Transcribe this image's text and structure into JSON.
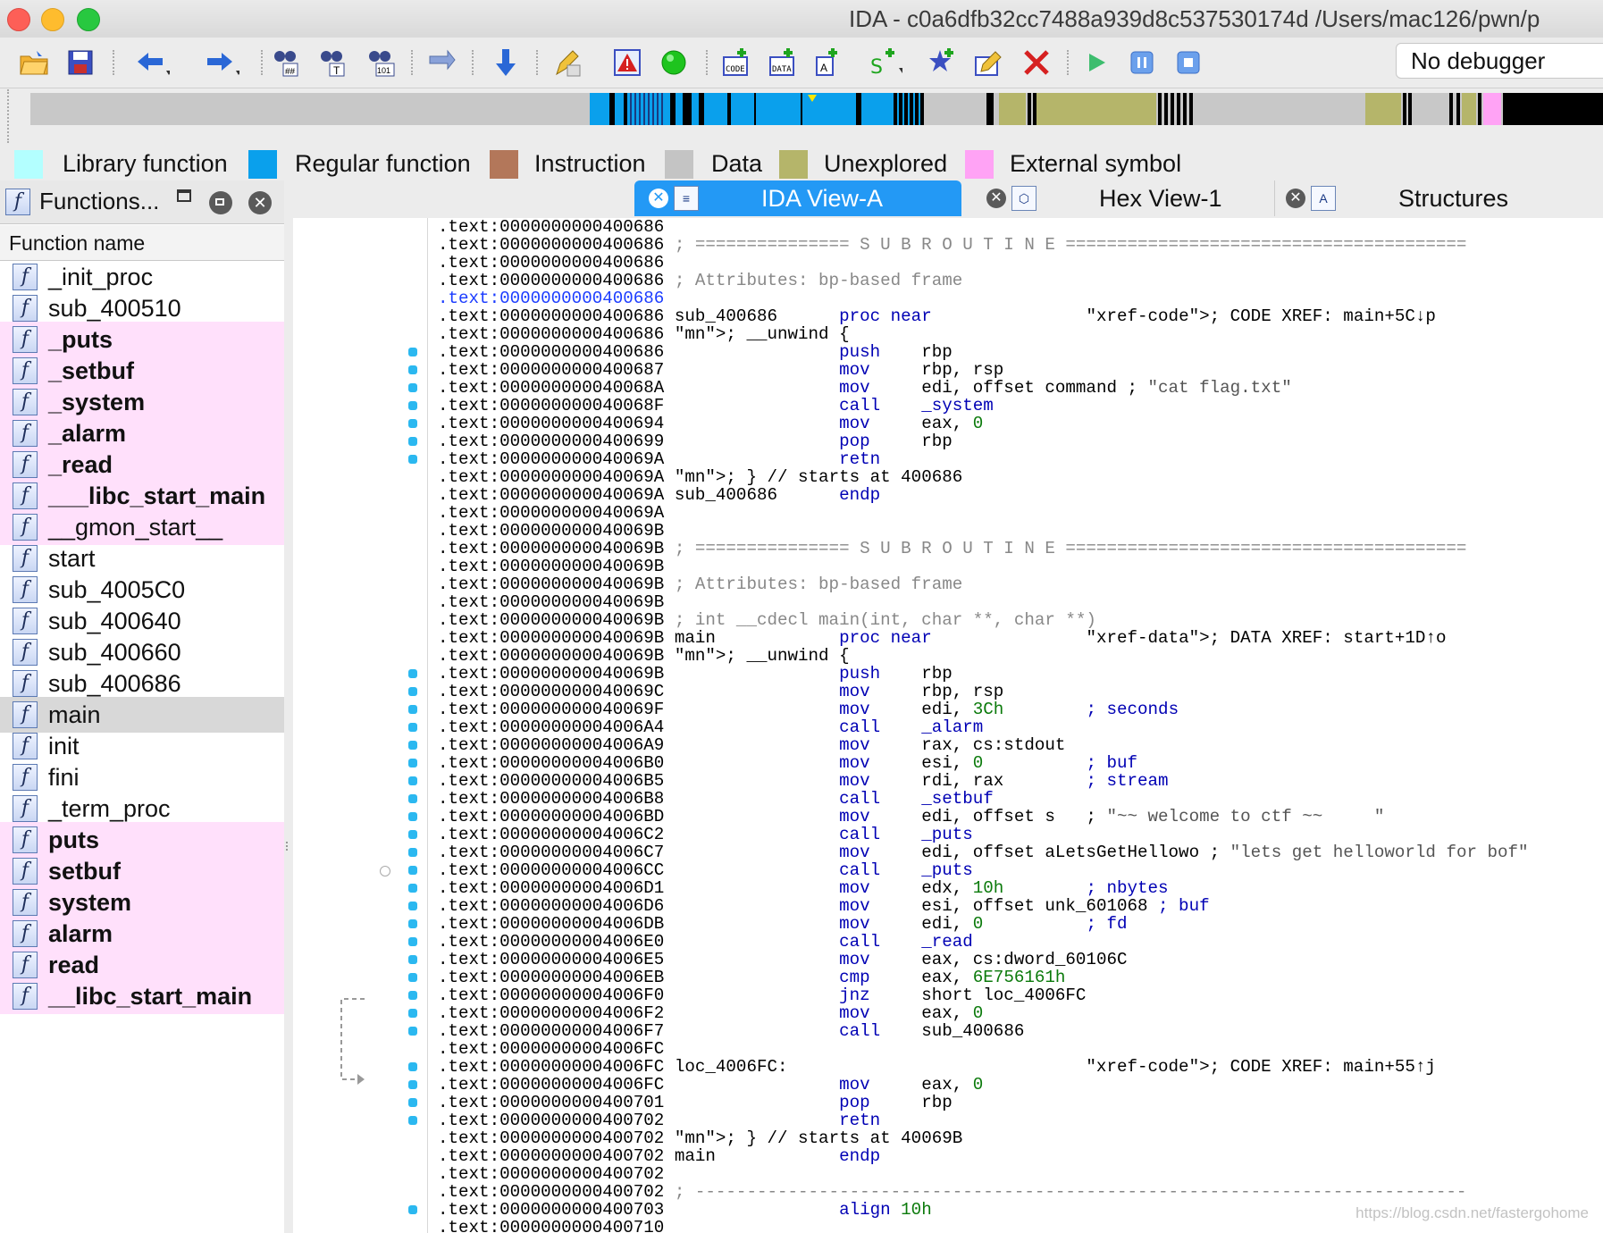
{
  "window": {
    "title": "IDA - c0a6dfb32cc7488a939d8c537530174d /Users/mac126/pwn/p"
  },
  "toolbar": {
    "debugger_select": "No debugger"
  },
  "legend": {
    "items": [
      {
        "label": "Library function",
        "color": "#b3ffff"
      },
      {
        "label": "Regular function",
        "color": "#0aa0ec"
      },
      {
        "label": "Instruction",
        "color": "#b3775a"
      },
      {
        "label": "Data",
        "color": "#c4c4c4"
      },
      {
        "label": "Unexplored",
        "color": "#b5b56a"
      },
      {
        "label": "External symbol",
        "color": "#ffa3f5"
      }
    ]
  },
  "functions_panel": {
    "title": "Functions...",
    "column_header": "Function name",
    "items": [
      {
        "name": "_init_proc",
        "kind": "regular"
      },
      {
        "name": "sub_400510",
        "kind": "regular"
      },
      {
        "name": "_puts",
        "kind": "import"
      },
      {
        "name": "_setbuf",
        "kind": "import"
      },
      {
        "name": "_system",
        "kind": "import"
      },
      {
        "name": "_alarm",
        "kind": "import"
      },
      {
        "name": "_read",
        "kind": "import"
      },
      {
        "name": "___libc_start_main",
        "kind": "import"
      },
      {
        "name": "__gmon_start__",
        "kind": "import-normal"
      },
      {
        "name": "start",
        "kind": "regular"
      },
      {
        "name": "sub_4005C0",
        "kind": "regular"
      },
      {
        "name": "sub_400640",
        "kind": "regular"
      },
      {
        "name": "sub_400660",
        "kind": "regular"
      },
      {
        "name": "sub_400686",
        "kind": "regular"
      },
      {
        "name": "main",
        "kind": "selected"
      },
      {
        "name": "init",
        "kind": "regular"
      },
      {
        "name": "fini",
        "kind": "regular"
      },
      {
        "name": "_term_proc",
        "kind": "regular"
      },
      {
        "name": "puts",
        "kind": "import"
      },
      {
        "name": "setbuf",
        "kind": "import"
      },
      {
        "name": "system",
        "kind": "import"
      },
      {
        "name": "alarm",
        "kind": "import"
      },
      {
        "name": "read",
        "kind": "import"
      },
      {
        "name": "__libc_start_main",
        "kind": "import"
      }
    ]
  },
  "tabs": [
    {
      "label": "IDA View-A",
      "active": true
    },
    {
      "label": "Hex View-1",
      "active": false
    },
    {
      "label": "Structures",
      "active": false
    }
  ],
  "disasm_lines": [
    ".text:0000000000400686",
    ".text:0000000000400686 ; =============== S U B R O U T I N E =======================================",
    ".text:0000000000400686",
    ".text:0000000000400686 ; Attributes: bp-based frame",
    ".text:0000000000400686",
    ".text:0000000000400686 sub_400686      proc near               ; CODE XREF: main+5C↓p",
    ".text:0000000000400686 ; __unwind {",
    ".text:0000000000400686                 push    rbp",
    ".text:0000000000400687                 mov     rbp, rsp",
    ".text:000000000040068A                 mov     edi, offset command ; \"cat flag.txt\"",
    ".text:000000000040068F                 call    _system",
    ".text:0000000000400694                 mov     eax, 0",
    ".text:0000000000400699                 pop     rbp",
    ".text:000000000040069A                 retn",
    ".text:000000000040069A ; } // starts at 400686",
    ".text:000000000040069A sub_400686      endp",
    ".text:000000000040069A",
    ".text:000000000040069B",
    ".text:000000000040069B ; =============== S U B R O U T I N E =======================================",
    ".text:000000000040069B",
    ".text:000000000040069B ; Attributes: bp-based frame",
    ".text:000000000040069B",
    ".text:000000000040069B ; int __cdecl main(int, char **, char **)",
    ".text:000000000040069B main            proc near               ; DATA XREF: start+1D↑o",
    ".text:000000000040069B ; __unwind {",
    ".text:000000000040069B                 push    rbp",
    ".text:000000000040069C                 mov     rbp, rsp",
    ".text:000000000040069F                 mov     edi, 3Ch        ; seconds",
    ".text:00000000004006A4                 call    _alarm",
    ".text:00000000004006A9                 mov     rax, cs:stdout",
    ".text:00000000004006B0                 mov     esi, 0          ; buf",
    ".text:00000000004006B5                 mov     rdi, rax        ; stream",
    ".text:00000000004006B8                 call    _setbuf",
    ".text:00000000004006BD                 mov     edi, offset s   ; \"~~ welcome to ctf ~~     \"",
    ".text:00000000004006C2                 call    _puts",
    ".text:00000000004006C7                 mov     edi, offset aLetsGetHellowo ; \"lets get helloworld for bof\"",
    ".text:00000000004006CC                 call    _puts",
    ".text:00000000004006D1                 mov     edx, 10h        ; nbytes",
    ".text:00000000004006D6                 mov     esi, offset unk_601068 ; buf",
    ".text:00000000004006DB                 mov     edi, 0          ; fd",
    ".text:00000000004006E0                 call    _read",
    ".text:00000000004006E5                 mov     eax, cs:dword_60106C",
    ".text:00000000004006EB                 cmp     eax, 6E756161h",
    ".text:00000000004006F0                 jnz     short loc_4006FC",
    ".text:00000000004006F2                 mov     eax, 0",
    ".text:00000000004006F7                 call    sub_400686",
    ".text:00000000004006FC",
    ".text:00000000004006FC loc_4006FC:                             ; CODE XREF: main+55↑j",
    ".text:00000000004006FC                 mov     eax, 0",
    ".text:0000000000400701                 pop     rbp",
    ".text:0000000000400702                 retn",
    ".text:0000000000400702 ; } // starts at 40069B",
    ".text:0000000000400702 main            endp",
    ".text:0000000000400702",
    ".text:0000000000400702 ; ---------------------------------------------------------------------------",
    ".text:0000000000400703                 align 10h",
    ".text:0000000000400710"
  ],
  "watermark": "https://blog.csdn.net/fastergohome"
}
